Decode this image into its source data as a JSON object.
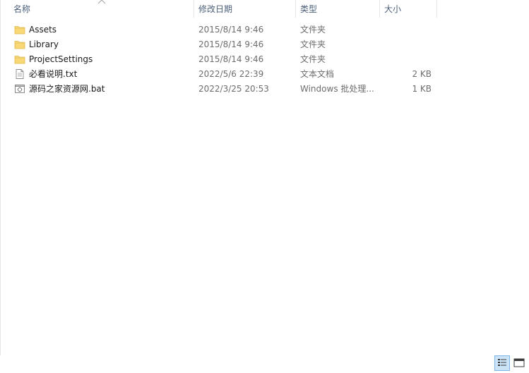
{
  "columns": {
    "name": "名称",
    "date": "修改日期",
    "type": "类型",
    "size": "大小"
  },
  "files": [
    {
      "name": "Assets",
      "date": "2015/8/14 9:46",
      "type": "文件夹",
      "size": "",
      "icon": "folder-icon"
    },
    {
      "name": "Library",
      "date": "2015/8/14 9:46",
      "type": "文件夹",
      "size": "",
      "icon": "folder-icon"
    },
    {
      "name": "ProjectSettings",
      "date": "2015/8/14 9:46",
      "type": "文件夹",
      "size": "",
      "icon": "folder-icon"
    },
    {
      "name": "必看说明.txt",
      "date": "2022/5/6 22:39",
      "type": "文本文档",
      "size": "2 KB",
      "icon": "text-file-icon"
    },
    {
      "name": "源码之家资源网.bat",
      "date": "2022/3/25 20:53",
      "type": "Windows 批处理...",
      "size": "1 KB",
      "icon": "batch-file-icon"
    }
  ],
  "colors": {
    "header_text": "#4c607a",
    "folder": "#f8d775",
    "selected_view_bg": "#cce4f7"
  }
}
